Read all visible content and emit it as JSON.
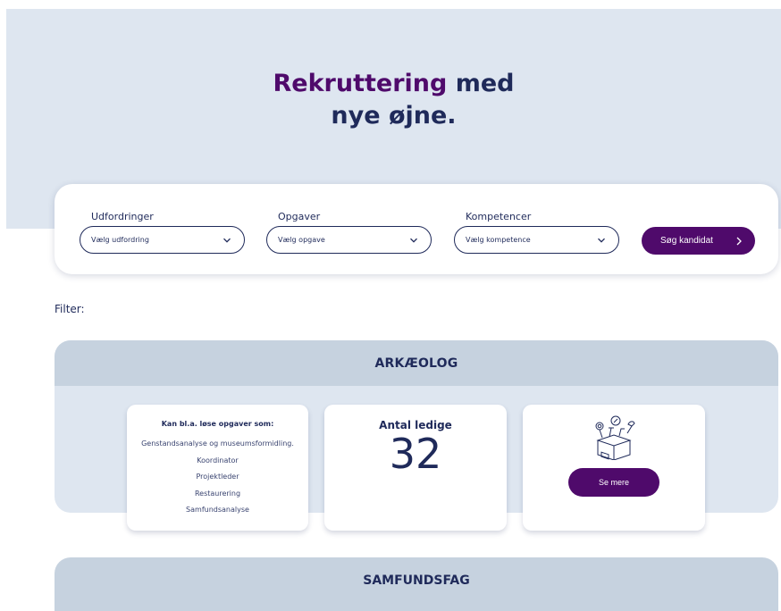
{
  "hero": {
    "title_accent": "Rekruttering",
    "title_rest": " med",
    "title_line2": "nye øjne."
  },
  "search": {
    "fields": [
      {
        "label": "Udfordringer",
        "placeholder": "Vælg udfordring"
      },
      {
        "label": "Opgaver",
        "placeholder": "Vælg opgave"
      },
      {
        "label": "Kompetencer",
        "placeholder": "Vælg kompetence"
      }
    ],
    "button_label": "Søg kandidat"
  },
  "filter_label": "Filter:",
  "professions": [
    {
      "title": "ARKÆOLOG",
      "tasks_heading": "Kan bl.a. løse opgaver som:",
      "tasks": [
        "Genstandsanalyse og museumsformidling.",
        "Koordinator",
        "Projektleder",
        "Restaurering",
        "Samfundsanalyse"
      ],
      "count_label": "Antal ledige",
      "count_value": "32",
      "more_label": "Se mere"
    },
    {
      "title": "SAMFUNDSFAG"
    }
  ],
  "colors": {
    "accent": "#4f0a6b",
    "navy": "#1f2a5a",
    "hero_bg": "#dee6f0",
    "card_head": "#c6d2df"
  }
}
